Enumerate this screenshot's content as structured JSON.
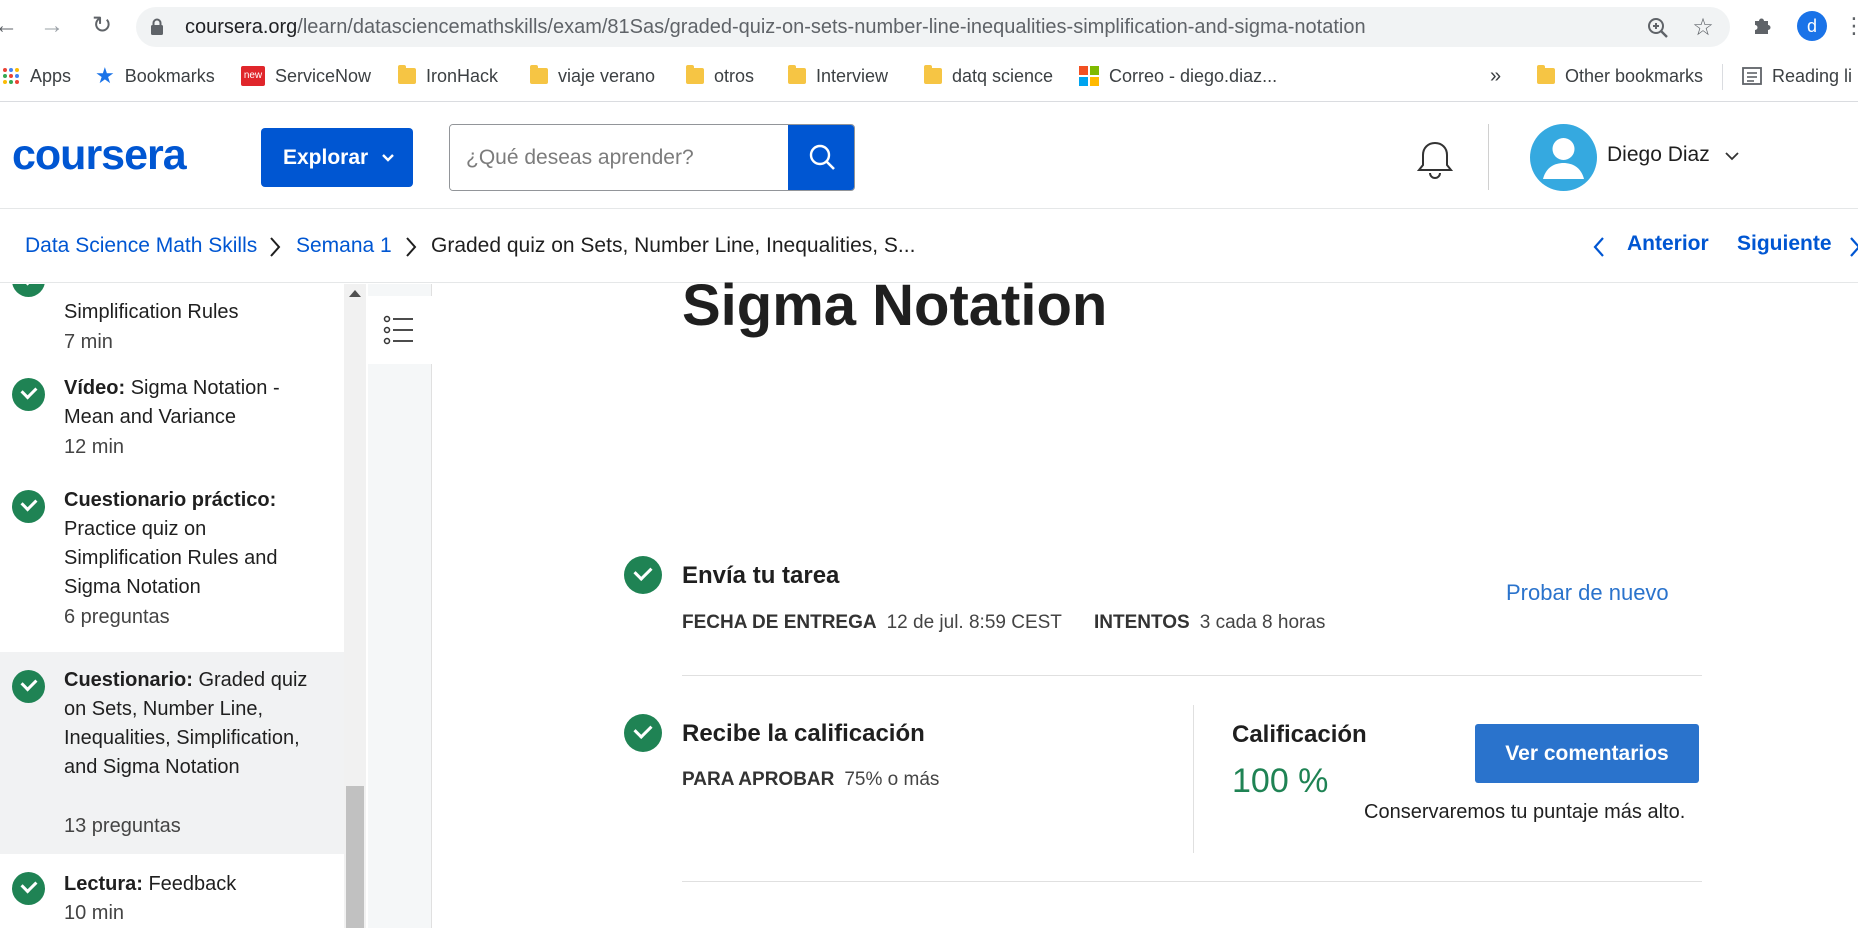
{
  "browser": {
    "url_domain": "coursera.org",
    "url_path": "/learn/datasciencemathskills/exam/81Sas/graded-quiz-on-sets-number-line-inequalities-simplification-and-sigma-notation",
    "profile_initial": "d",
    "bookmarks": [
      {
        "label": "Apps",
        "icon": "apps-grid-icon"
      },
      {
        "label": "Bookmarks",
        "icon": "star-icon"
      },
      {
        "label": "ServiceNow",
        "icon": "servicenow-icon"
      },
      {
        "label": "IronHack",
        "icon": "folder-icon"
      },
      {
        "label": "viaje verano",
        "icon": "folder-icon"
      },
      {
        "label": "otros",
        "icon": "folder-icon"
      },
      {
        "label": "Interview",
        "icon": "folder-icon"
      },
      {
        "label": "datq science",
        "icon": "folder-icon"
      },
      {
        "label": "Correo - diego.diaz...",
        "icon": "microsoft-icon"
      }
    ],
    "overflow": "»",
    "other_bookmarks": "Other bookmarks",
    "reading_list": "Reading li"
  },
  "header": {
    "logo": "coursera",
    "explore_label": "Explorar",
    "search_placeholder": "¿Qué deseas aprender?",
    "user_name": "Diego Diaz"
  },
  "breadcrumb": {
    "course": "Data Science Math Skills",
    "week": "Semana 1",
    "current": "Graded quiz on Sets, Number Line, Inequalities, S...",
    "prev": "Anterior",
    "next": "Siguiente"
  },
  "sidebar": {
    "items": [
      {
        "title": "Simplification Rules",
        "meta": "7 min"
      },
      {
        "type": "Vídeo:",
        "title": "Sigma Notation - Mean and Variance",
        "meta": "12 min"
      },
      {
        "type": "Cuestionario práctico:",
        "title": "Practice quiz on Simplification Rules and Sigma Notation",
        "meta": "6 preguntas"
      },
      {
        "type": "Cuestionario:",
        "title": "Graded quiz on Sets, Number Line, Inequalities, Simplification, and Sigma Notation",
        "meta": "13 preguntas"
      },
      {
        "type": "Lectura:",
        "title": "Feedback",
        "meta": "10 min"
      }
    ]
  },
  "main": {
    "heading": "Sigma Notation",
    "submit": {
      "title": "Envía tu tarea",
      "due_label": "FECHA DE ENTREGA",
      "due_value": "12 de jul. 8:59 CEST",
      "attempts_label": "INTENTOS",
      "attempts_value": "3 cada 8 horas",
      "retry": "Probar de nuevo"
    },
    "grade": {
      "title": "Recibe la calificación",
      "pass_label": "PARA APROBAR",
      "pass_value": "75% o más",
      "grade_label": "Calificación",
      "grade_value": "100 %",
      "feedback_button": "Ver comentarios",
      "note": "Conservaremos tu puntaje más alto."
    }
  },
  "colors": {
    "brand": "#0056d2",
    "success": "#1f8354",
    "button": "#2a73cc"
  }
}
